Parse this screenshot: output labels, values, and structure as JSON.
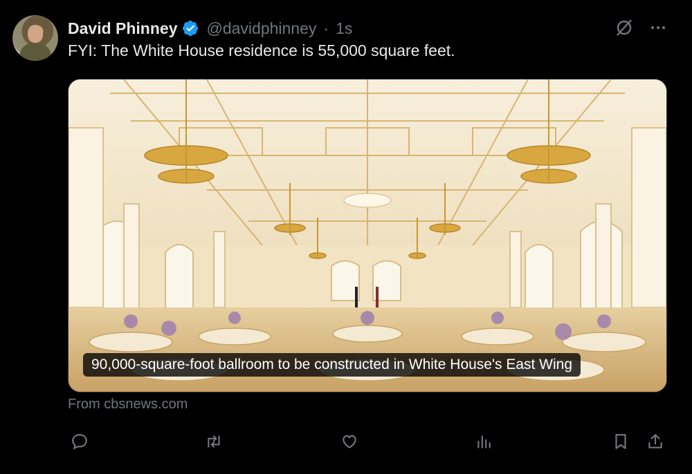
{
  "post": {
    "author_name": "David Phinney",
    "handle": "@davidphinney",
    "separator": "·",
    "time": "1s",
    "text": "FYI: The White House residence is 55,000 square feet."
  },
  "card": {
    "caption": "90,000-square-foot ballroom to be constructed in White House's East Wing",
    "source": "From cbsnews.com"
  },
  "icons": {
    "verified": "verified-badge-icon",
    "grok": "grok-icon",
    "more": "more-icon",
    "reply": "reply-icon",
    "repost": "repost-icon",
    "like": "like-icon",
    "views": "views-icon",
    "bookmark": "bookmark-icon",
    "share": "share-icon"
  },
  "colors": {
    "background": "#000000",
    "text": "#e7e9ea",
    "muted": "#71767b",
    "verified": "#1d9bf0"
  }
}
